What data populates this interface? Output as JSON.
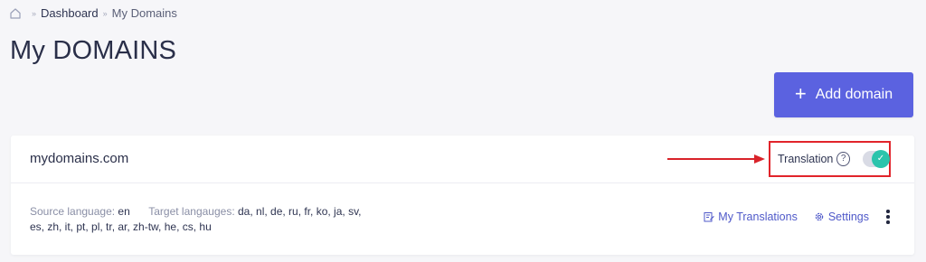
{
  "breadcrumb": {
    "home_icon": "home-icon",
    "separator": "»",
    "items": [
      "Dashboard",
      "My Domains"
    ]
  },
  "page": {
    "title": "My DOMAINS"
  },
  "toolbar": {
    "add_domain_icon": "plus-icon",
    "add_domain_label": "Add domain"
  },
  "domains": [
    {
      "name": "mydomains.com",
      "translation": {
        "label": "Translation",
        "help_icon": "question-icon",
        "help_symbol": "?",
        "enabled": true,
        "toggle_symbol": "✓"
      },
      "source_language_label": "Source language:",
      "source_language": "en",
      "target_languages_label": "Target langauges:",
      "target_languages_line1": "da, nl, de, ru, fr, ko, ja, sv,",
      "target_languages_line2": "es, zh, it, pt, pl, tr, ar, zh-tw, he, cs, hu",
      "actions": {
        "my_translations_label": "My Translations",
        "my_translations_icon": "edit-document-icon",
        "settings_label": "Settings",
        "settings_icon": "gear-icon",
        "more_icon": "kebab-menu-icon"
      }
    }
  ],
  "colors": {
    "accent": "#5b62e0",
    "toggle_on": "#2cc4ac",
    "highlight": "#e1242b",
    "link": "#4f59c9",
    "background": "#f6f6f9"
  }
}
